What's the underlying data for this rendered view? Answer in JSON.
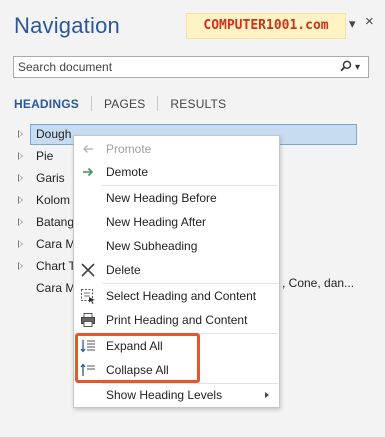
{
  "pane": {
    "title": "Navigation",
    "watermark": "COMPUTER1001.com",
    "options_glyph": "▾",
    "close_glyph": "×"
  },
  "search": {
    "placeholder": "Search document",
    "icon": "search-icon",
    "dropdown_glyph": "▾"
  },
  "tabs": [
    {
      "label": "HEADINGS",
      "active": true
    },
    {
      "label": "PAGES",
      "active": false
    },
    {
      "label": "RESULTS",
      "active": false
    }
  ],
  "tree": {
    "items": [
      {
        "label": "Dough",
        "selected": true,
        "expandable": true
      },
      {
        "label": "Pie",
        "selected": false,
        "expandable": true
      },
      {
        "label": "Garis",
        "selected": false,
        "expandable": true
      },
      {
        "label": "Kolom",
        "selected": false,
        "expandable": true
      },
      {
        "label": "Batang",
        "selected": false,
        "expandable": true
      },
      {
        "label": "Cara M",
        "selected": false,
        "expandable": true
      },
      {
        "label": "Chart T",
        "selected": false,
        "expandable": true
      },
      {
        "label": "Cara M",
        "selected": false,
        "expandable": false
      }
    ],
    "trailing_text": ", Cone, dan..."
  },
  "context_menu": {
    "items": [
      {
        "label": "Promote",
        "icon": "promote-arrow-icon",
        "enabled": false
      },
      {
        "label": "Demote",
        "icon": "demote-arrow-icon",
        "enabled": true
      },
      {
        "label": "New Heading Before",
        "icon": "",
        "enabled": true
      },
      {
        "label": "New Heading After",
        "icon": "",
        "enabled": true
      },
      {
        "label": "New Subheading",
        "icon": "",
        "enabled": true
      },
      {
        "label": "Delete",
        "icon": "delete-x-icon",
        "enabled": true
      },
      {
        "label": "Select Heading and Content",
        "icon": "select-content-icon",
        "enabled": true
      },
      {
        "label": "Print Heading and Content",
        "icon": "printer-icon",
        "enabled": true
      },
      {
        "label": "Expand All",
        "icon": "expand-all-icon",
        "enabled": true
      },
      {
        "label": "Collapse All",
        "icon": "collapse-all-icon",
        "enabled": true
      },
      {
        "label": "Show Heading Levels",
        "icon": "",
        "enabled": true,
        "has_submenu": true
      }
    ]
  },
  "colors": {
    "title_blue": "#2b579a",
    "selection_fill": "#c8dcf1",
    "selection_border": "#7aa7d6",
    "callout_orange": "#e8562a",
    "watermark_red": "#d2311b",
    "watermark_bg": "#fdf3c4",
    "demote_green": "#3a9b58"
  }
}
